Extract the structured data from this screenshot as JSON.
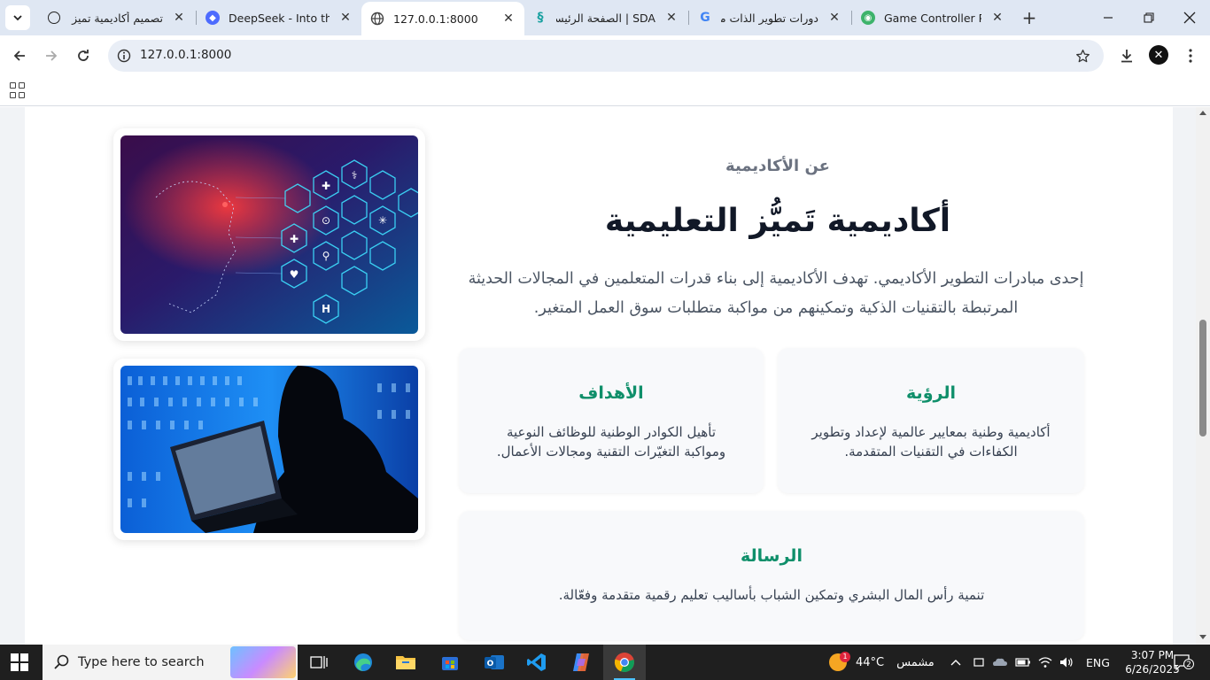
{
  "browser": {
    "tabs": [
      {
        "title": "تصميم أكاديمية تميز",
        "icon": "openai-icon",
        "active": false
      },
      {
        "title": "DeepSeek - Into the Unknown",
        "icon": "deepseek-icon",
        "active": false
      },
      {
        "title": "127.0.0.1:8000",
        "icon": "globe-icon",
        "active": true
      },
      {
        "title": "SDA | الصفحة الرئيسية",
        "icon": "sda-icon",
        "active": false
      },
      {
        "title": "دورات تطوير الذات مجانية",
        "icon": "google-icon",
        "active": false
      },
      {
        "title": "Game Controller PNG",
        "icon": "pngtree-icon",
        "active": false
      }
    ],
    "url": "127.0.0.1:8000"
  },
  "page": {
    "eyebrow": "عن الأكاديمية",
    "heading": "أكاديمية تَميُّز التعليمية",
    "lead": "إحدى مبادرات التطوير الأكاديمي. تهدف الأكاديمية إلى بناء قدرات المتعلمين في المجالات الحديثة المرتبطة بالتقنيات الذكية وتمكينهم من مواكبة متطلبات سوق العمل المتغير.",
    "cards": {
      "vision": {
        "title": "الرؤية",
        "text": "أكاديمية وطنية بمعايير عالمية لإعداد وتطوير الكفاءات في التقنيات المتقدمة."
      },
      "goals": {
        "title": "الأهداف",
        "text": "تأهيل الكوادر الوطنية للوظائف النوعية ومواكبة التغيّرات التقنية ومجالات الأعمال."
      },
      "mission": {
        "title": "الرسالة",
        "text": "تنمية رأس المال البشري وتمكين الشباب بأساليب تعليم رقمية متقدمة وفعّالة."
      }
    },
    "images": [
      "ai-healthcare-image",
      "hacker-laptop-image"
    ]
  },
  "taskbar": {
    "search_placeholder": "Type here to search",
    "weather_temp": "44°C",
    "weather_text": "مشمس",
    "weather_badge": "1",
    "language": "ENG",
    "time": "3:07 PM",
    "date": "6/26/2025",
    "notifications": "2"
  },
  "colors": {
    "accent_green": "#0f8f6a",
    "heading": "#111827",
    "tabstrip": "#dfe7f3"
  }
}
